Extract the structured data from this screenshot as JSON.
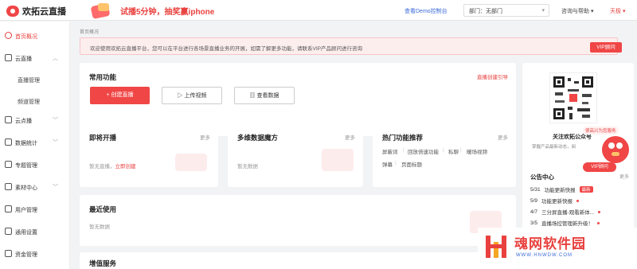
{
  "app": {
    "name": "欢拓云直播"
  },
  "header": {
    "promo": "试播5分钟，抽奖赢iphone",
    "demo_link": "查看Demo控制台",
    "dept_select": "部门：无部门",
    "help": "咨询与帮助",
    "user": "天极"
  },
  "sidebar": {
    "items": [
      {
        "label": "首页概况",
        "icon": "home-icon",
        "caret": ""
      },
      {
        "label": "云直播",
        "icon": "live-icon",
        "caret": "︿"
      },
      {
        "label": "直播管理"
      },
      {
        "label": "频道管理"
      },
      {
        "label": "云点播",
        "icon": "vod-icon",
        "caret": "﹀"
      },
      {
        "label": "数据统计",
        "icon": "stats-icon",
        "caret": "﹀"
      },
      {
        "label": "专题管理",
        "icon": "topic-icon",
        "caret": ""
      },
      {
        "label": "素材中心",
        "icon": "material-icon",
        "caret": "﹀"
      },
      {
        "label": "用户管理",
        "icon": "user-icon",
        "caret": ""
      },
      {
        "label": "通用设置",
        "icon": "settings-icon",
        "caret": ""
      },
      {
        "label": "资金管理",
        "icon": "wallet-icon",
        "caret": ""
      }
    ]
  },
  "main": {
    "breadcrumb": "首页概况",
    "notice": {
      "text": "欢迎使用欢拓云直播平台，您可以在平台进行各场景直播业务的开展，如需了解更多功能，请联系VIP产品顾问进行咨询",
      "button": "VIP顾问"
    },
    "common": {
      "title": "常用功能",
      "guide": "直播创建引导",
      "create": "+ 创建直播",
      "upload": "上传视频",
      "data": "查看数据"
    },
    "upcoming": {
      "title": "即将开播",
      "more": "更多",
      "empty": "暂无直播，",
      "create_link": "立即创建"
    },
    "data_cube": {
      "title": "多维数据魔方",
      "more": "更多",
      "empty": "暂无数据"
    },
    "hot": {
      "title": "热门功能推荐",
      "more": "更多",
      "tags": [
        "屏蔽词",
        "回放倍速功能",
        "私聊",
        "暖场视频",
        "弹幕",
        "页面标题"
      ]
    },
    "recent": {
      "title": "最近使用",
      "empty": "暂无数据"
    },
    "value": {
      "title": "增值服务"
    },
    "right": {
      "follow": "关注欢拓公众号",
      "desc": "掌握产品最新动态，阅",
      "service": "很高兴为您服务",
      "vip": "VIP顾问",
      "announce": "公告中心",
      "announce_more": "更多",
      "news": [
        {
          "date": "5/31",
          "text": "功能更新快报",
          "badge": "最新"
        },
        {
          "date": "5/9",
          "text": "功能更新快报",
          "badge": ""
        },
        {
          "date": "4/7",
          "text": "三分屏直播-观看新体...",
          "badge": ""
        },
        {
          "date": "3/5",
          "text": "直播场控管理新升级！",
          "badge": ""
        }
      ]
    }
  },
  "watermark": {
    "text": "魂网软件园",
    "url": "WWW.HNWDW.COM"
  }
}
